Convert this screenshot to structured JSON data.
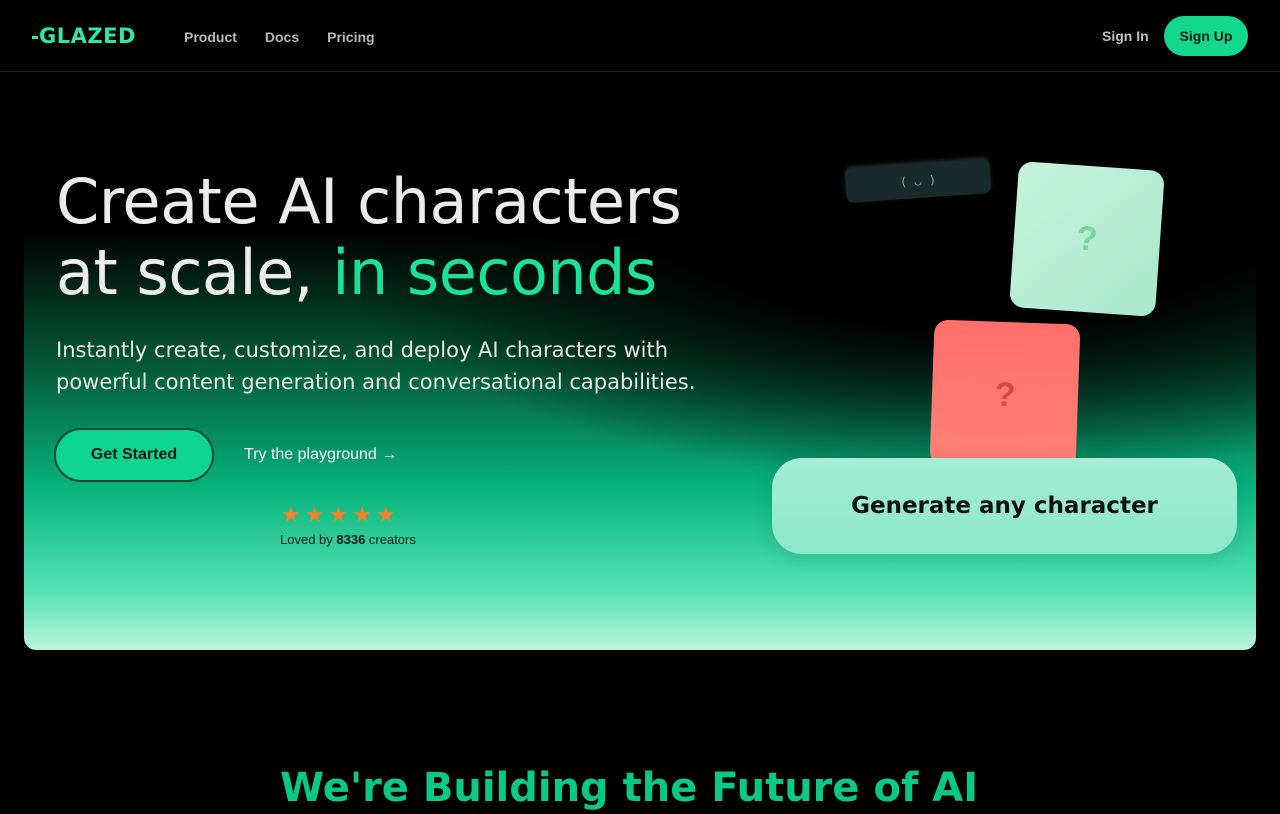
{
  "nav": {
    "logo": "GLAZED",
    "links": [
      "Product",
      "Docs",
      "Pricing"
    ],
    "signin": "Sign In",
    "signup": "Sign Up"
  },
  "hero": {
    "headline_line1": "Create AI characters",
    "headline_line2_prefix": "at scale, ",
    "headline_line2_accent": "in seconds",
    "subtext": "Instantly create, customize, and deploy AI characters with powerful content generation and conversational capabilities.",
    "cta_primary": "Get Started",
    "cta_secondary": "Try the playground →",
    "rating": {
      "stars": 5,
      "loved_prefix": "Loved by ",
      "count": "8336",
      "loved_suffix": " creators"
    },
    "card_question": "?",
    "generate_label": "Generate any character"
  },
  "section": {
    "title": "We're Building the Future of AI"
  },
  "colors": {
    "accent": "#19e39b",
    "star": "#f0842c",
    "card_red": "#ff6f6a",
    "card_green": "#c5f2de"
  },
  "icons": [
    "star-icon",
    "arrow-right-icon",
    "loader-icon"
  ]
}
